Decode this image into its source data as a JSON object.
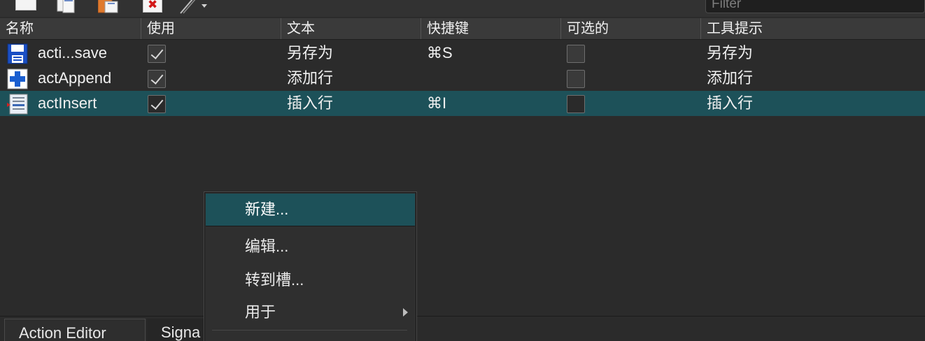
{
  "toolbar": {
    "buttons": [
      {
        "name": "new-action",
        "icon": "new-document-icon"
      },
      {
        "name": "copy-action",
        "icon": "copy-icon"
      },
      {
        "name": "paste-action",
        "icon": "paste-icon"
      },
      {
        "name": "delete-action",
        "icon": "delete-icon"
      },
      {
        "name": "configure-action",
        "icon": "pen-dropdown-icon"
      }
    ],
    "filter_placeholder": "Filter"
  },
  "table": {
    "columns": [
      "名称",
      "使用",
      "文本",
      "快捷键",
      "可选的",
      "工具提示"
    ],
    "rows": [
      {
        "name": "acti...save",
        "icon": "save-floppy-icon",
        "used": true,
        "text": "另存为",
        "shortcut": "⌘S",
        "checkable": false,
        "tooltip": "另存为",
        "selected": false
      },
      {
        "name": "actAppend",
        "icon": "add-plus-icon",
        "used": true,
        "text": "添加行",
        "shortcut": "",
        "checkable": false,
        "tooltip": "添加行",
        "selected": false
      },
      {
        "name": "actInsert",
        "icon": "insert-row-icon",
        "used": true,
        "text": "插入行",
        "shortcut": "⌘I",
        "checkable": false,
        "tooltip": "插入行",
        "selected": true
      }
    ]
  },
  "context_menu": {
    "items": [
      {
        "label": "新建...",
        "highlighted": true,
        "submenu": false
      },
      {
        "label": "编辑...",
        "highlighted": false,
        "submenu": false
      },
      {
        "label": "转到槽...",
        "highlighted": false,
        "submenu": false
      },
      {
        "label": "用于",
        "highlighted": false,
        "submenu": true
      }
    ]
  },
  "tabs": [
    "Action Editor",
    "Signa"
  ],
  "colors": {
    "selection": "#1d5159",
    "background": "#2b2b2b",
    "header": "#3a3a3a"
  }
}
